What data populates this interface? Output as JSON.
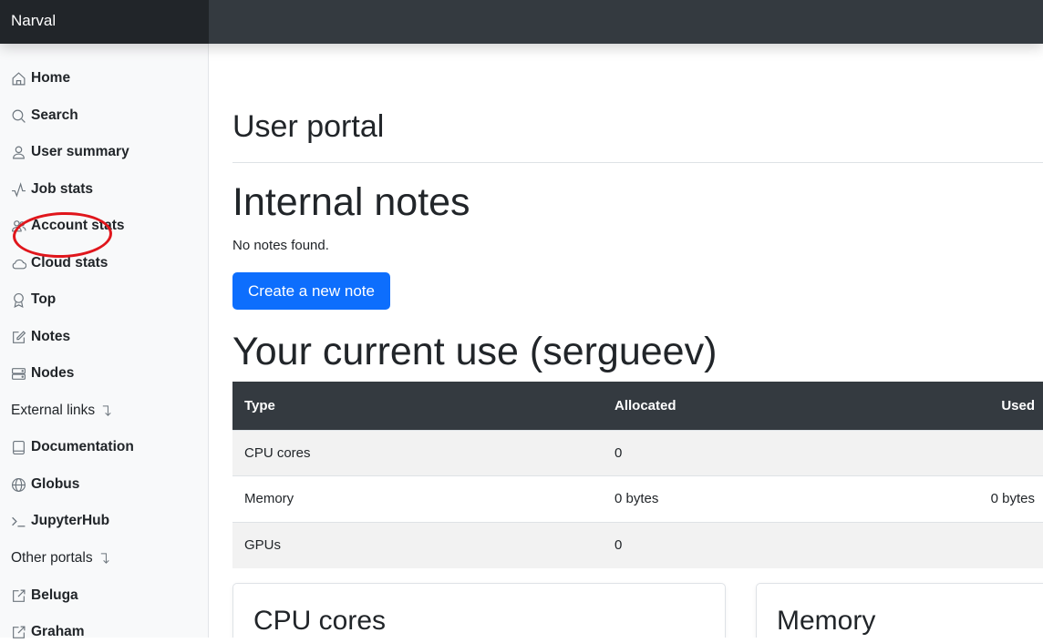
{
  "brand": "Narval",
  "sidebar": {
    "items": [
      {
        "label": "Home",
        "icon": "house-icon"
      },
      {
        "label": "Search",
        "icon": "search-icon"
      },
      {
        "label": "User summary",
        "icon": "person-icon"
      },
      {
        "label": "Job stats",
        "icon": "activity-icon"
      },
      {
        "label": "Account stats",
        "icon": "people-icon"
      },
      {
        "label": "Cloud stats",
        "icon": "cloud-icon"
      },
      {
        "label": "Top",
        "icon": "award-icon"
      },
      {
        "label": "Notes",
        "icon": "pencil-square-icon"
      },
      {
        "label": "Nodes",
        "icon": "hdd-stack-icon"
      }
    ],
    "external_heading": "External links",
    "external": [
      {
        "label": "Documentation",
        "icon": "book-icon"
      },
      {
        "label": "Globus",
        "icon": "globe-icon"
      },
      {
        "label": "JupyterHub",
        "icon": "terminal-icon"
      }
    ],
    "other_heading": "Other portals",
    "other": [
      {
        "label": "Beluga",
        "icon": "external-link-icon"
      },
      {
        "label": "Graham",
        "icon": "external-link-icon"
      }
    ]
  },
  "main": {
    "page_title": "User portal",
    "notes_heading": "Internal notes",
    "notes_empty": "No notes found.",
    "create_note_button": "Create a new note",
    "usage_heading": "Your current use (sergueev)",
    "table": {
      "headers": [
        "Type",
        "Allocated",
        "Used"
      ],
      "rows": [
        [
          "CPU cores",
          "0",
          ""
        ],
        [
          "Memory",
          "0 bytes",
          "0 bytes"
        ],
        [
          "GPUs",
          "0",
          ""
        ]
      ]
    },
    "cards": [
      "CPU cores",
      "Memory"
    ]
  },
  "colors": {
    "navbar": "#343a40",
    "brand_bg": "#212529",
    "sidebar_bg": "#f8f9fa",
    "primary": "#0d6efd",
    "annotation": "#e0161c"
  }
}
